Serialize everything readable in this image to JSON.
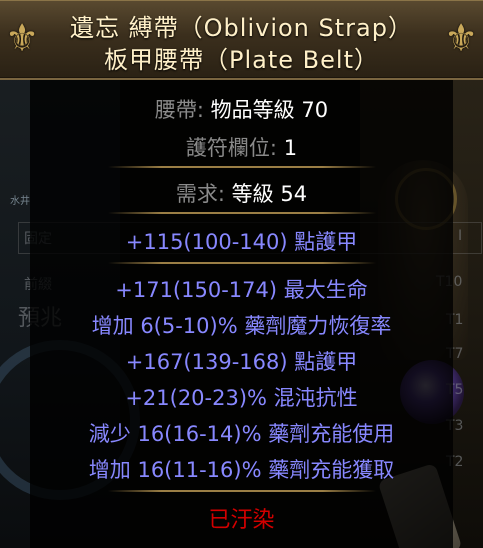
{
  "item": {
    "name": "遺忘 縛帶（Oblivion Strap）",
    "base": "板甲腰帶（Plate Belt）",
    "properties": {
      "type_label": "腰帶:",
      "type_value": "物品等級 70",
      "socket_label": "護符欄位:",
      "socket_value": "1",
      "req_label": "需求:",
      "req_value": "等級 54"
    },
    "implicit": "+115(100-140) 點護甲",
    "mods": [
      "+171(150-174) 最大生命",
      "增加 6(5-10)% 藥劑魔力恢復率",
      "+167(139-168) 點護甲",
      "+21(20-23)% 混沌抗性",
      "減少 16(16-14)% 藥劑充能使用",
      "增加 16(11-16)% 藥劑充能獲取"
    ],
    "corrupted": "已汙染"
  },
  "background": {
    "labels": {
      "fixed": "固定",
      "prefix": "前綴",
      "preview": "預兆",
      "map": "水井",
      "roman": "I"
    },
    "tiers": [
      "T10",
      "T1",
      "T7",
      "T5",
      "T3",
      "T2"
    ]
  },
  "colors": {
    "title": "#fff0c8",
    "property_label": "#8a8a8a",
    "property_value": "#ffffff",
    "magic_mod": "#8888ff",
    "corrupted": "#d20000",
    "frame_gold": "#9a7e45"
  }
}
